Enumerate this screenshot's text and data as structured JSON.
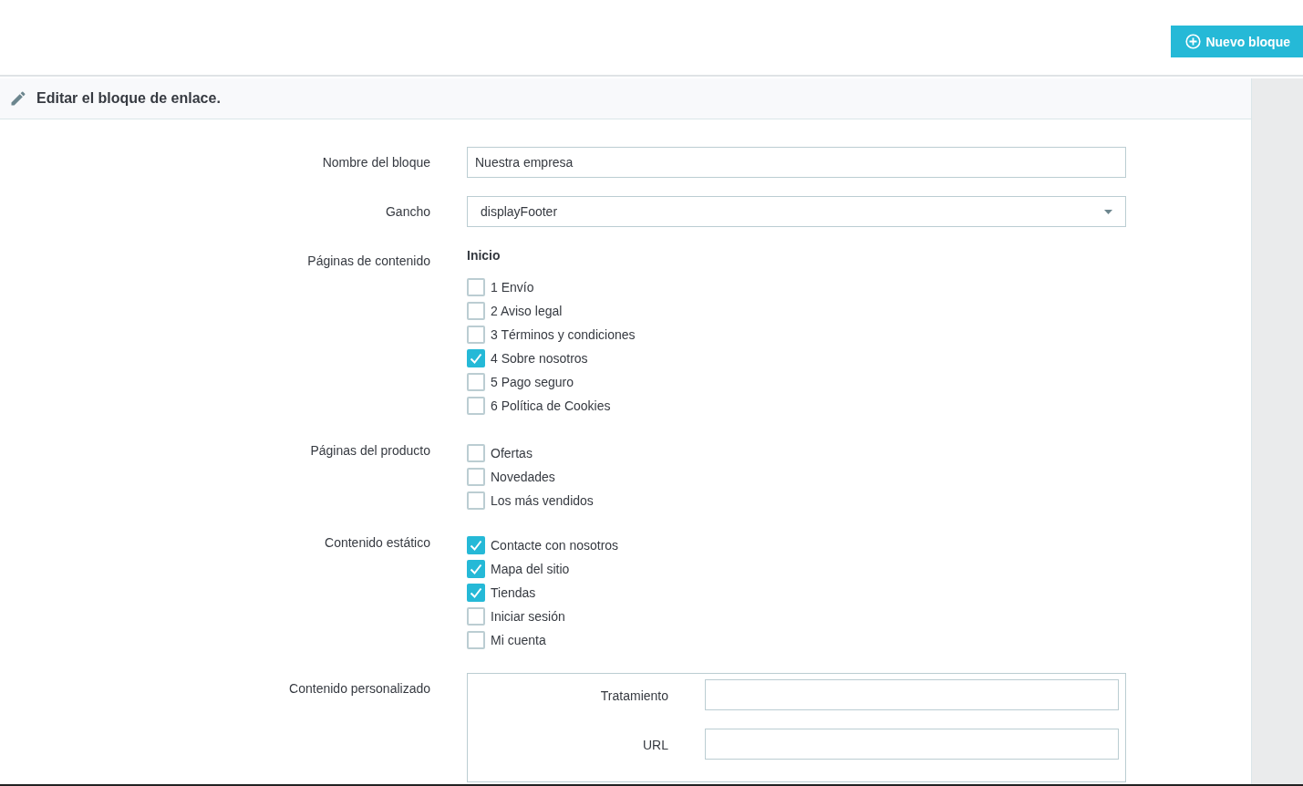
{
  "toolbar": {
    "new_button": "Nuevo bloque"
  },
  "panel": {
    "title": "Editar el bloque de enlace."
  },
  "fields": [
    {
      "kind": "text",
      "label": "Nombre del bloque",
      "value": "Nuestra empresa"
    },
    {
      "kind": "select",
      "label": "Gancho",
      "value": "displayFooter"
    },
    {
      "kind": "checkgroup",
      "label": "Páginas de contenido",
      "heading": "Inicio",
      "options": [
        {
          "label": "1 Envío",
          "checked": false
        },
        {
          "label": "2 Aviso legal",
          "checked": false
        },
        {
          "label": "3 Términos y condiciones",
          "checked": false
        },
        {
          "label": "4 Sobre nosotros",
          "checked": true
        },
        {
          "label": "5 Pago seguro",
          "checked": false
        },
        {
          "label": "6 Política de Cookies",
          "checked": false
        }
      ]
    },
    {
      "kind": "checkgroup",
      "label": "Páginas del producto",
      "options": [
        {
          "label": "Ofertas",
          "checked": false
        },
        {
          "label": "Novedades",
          "checked": false
        },
        {
          "label": "Los más vendidos",
          "checked": false
        }
      ]
    },
    {
      "kind": "checkgroup",
      "label": "Contenido estático",
      "options": [
        {
          "label": "Contacte con nosotros",
          "checked": true
        },
        {
          "label": "Mapa del sitio",
          "checked": true
        },
        {
          "label": "Tiendas",
          "checked": true
        },
        {
          "label": "Iniciar sesión",
          "checked": false
        },
        {
          "label": "Mi cuenta",
          "checked": false
        }
      ]
    },
    {
      "kind": "custom",
      "label": "Contenido personalizado",
      "rows": [
        {
          "label": "Tratamiento",
          "value": ""
        },
        {
          "label": "URL",
          "value": ""
        }
      ]
    }
  ]
}
